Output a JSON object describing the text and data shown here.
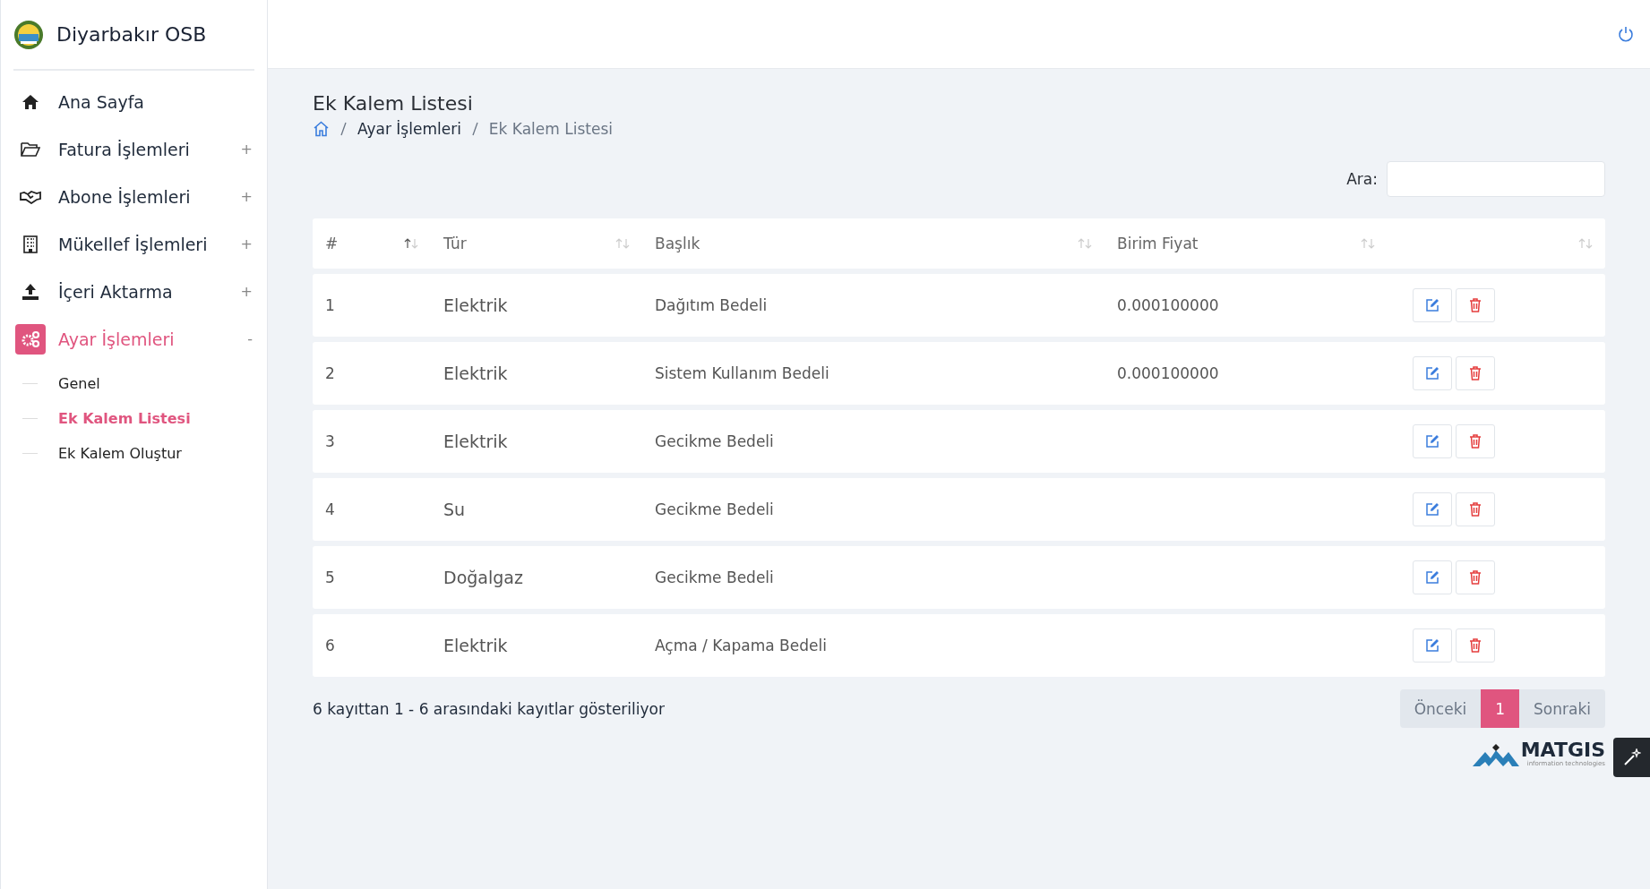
{
  "brand": {
    "name": "Diyarbakır OSB"
  },
  "sidebar": {
    "items": [
      {
        "label": "Ana Sayfa",
        "selected": false
      },
      {
        "label": "Fatura İşlemleri",
        "toggle": "+",
        "selected": false
      },
      {
        "label": "Abone İşlemleri",
        "toggle": "+",
        "selected": false
      },
      {
        "label": "Mükellef İşlemleri",
        "toggle": "+",
        "selected": false
      },
      {
        "label": "İçeri Aktarma",
        "toggle": "+",
        "selected": false
      },
      {
        "label": "Ayar İşlemleri",
        "toggle": "-",
        "selected": true,
        "children": [
          {
            "label": "Genel",
            "selected": false
          },
          {
            "label": "Ek Kalem Listesi",
            "selected": true
          },
          {
            "label": "Ek Kalem Oluştur",
            "selected": false
          }
        ]
      }
    ]
  },
  "page": {
    "title": "Ek Kalem Listesi",
    "breadcrumb": [
      "Ayar İşlemleri",
      "Ek Kalem Listesi"
    ]
  },
  "search": {
    "label": "Ara:"
  },
  "table": {
    "columns": [
      {
        "label": "#",
        "sorted": true
      },
      {
        "label": "Tür",
        "sorted": false
      },
      {
        "label": "Başlık",
        "sorted": false
      },
      {
        "label": "Birim Fiyat",
        "sorted": false
      },
      {
        "sorted": false
      }
    ],
    "rows": [
      {
        "no": "1",
        "type": "Elektrik",
        "title": "Dağıtım Bedeli",
        "price": "0.000100000"
      },
      {
        "no": "2",
        "type": "Elektrik",
        "title": "Sistem Kullanım Bedeli",
        "price": "0.000100000"
      },
      {
        "no": "3",
        "type": "Elektrik",
        "title": "Gecikme Bedeli"
      },
      {
        "no": "4",
        "type": "Su",
        "title": "Gecikme Bedeli"
      },
      {
        "no": "5",
        "type": "Doğalgaz",
        "title": "Gecikme Bedeli"
      },
      {
        "no": "6",
        "type": "Elektrik",
        "title": "Açma / Kapama Bedeli"
      }
    ]
  },
  "info": "6 kayıttan 1 - 6 arasındaki kayıtlar gösteriliyor",
  "pagination": {
    "previous": "Önceki",
    "pages": [
      {
        "label": "1",
        "selected": true
      }
    ],
    "next": "Sonraki"
  },
  "footer_logo": {
    "name": "MATGIS",
    "tagline": "information technologies"
  }
}
